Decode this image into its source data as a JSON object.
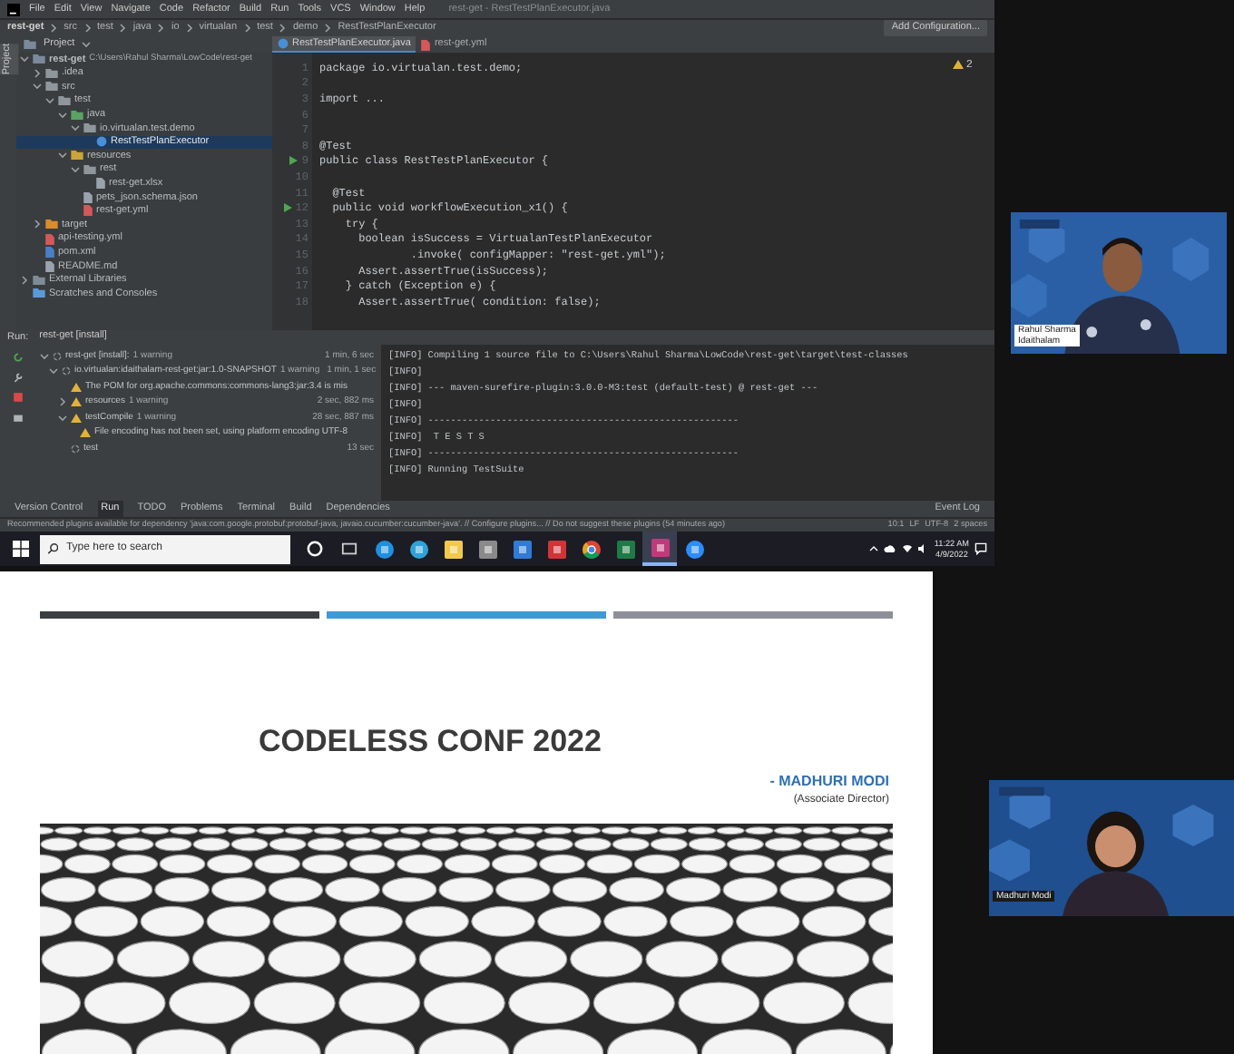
{
  "ide": {
    "menu": [
      "File",
      "Edit",
      "View",
      "Navigate",
      "Code",
      "Refactor",
      "Build",
      "Run",
      "Tools",
      "VCS",
      "Window",
      "Help"
    ],
    "title": "rest-get - RestTestPlanExecutor.java",
    "breadcrumbs": [
      "rest-get",
      "src",
      "test",
      "java",
      "io",
      "virtualan",
      "test",
      "demo",
      "RestTestPlanExecutor"
    ],
    "run_config": "Add Configuration...",
    "side_labels": [
      "Project"
    ],
    "project": {
      "title": "Project",
      "tree": [
        {
          "label": "rest-get",
          "detail": "C:\\Users\\Rahul Sharma\\LowCode\\rest-get",
          "kind": "module",
          "expanded": true,
          "selected": false,
          "children": [
            {
              "label": ".idea",
              "kind": "folder",
              "expanded": false,
              "selected": false
            },
            {
              "label": "src",
              "kind": "folder",
              "expanded": true,
              "selected": false,
              "children": [
                {
                  "label": "test",
                  "kind": "folder",
                  "expanded": true,
                  "selected": false,
                  "children": [
                    {
                      "label": "java",
                      "kind": "source",
                      "expanded": true,
                      "selected": false,
                      "children": [
                        {
                          "label": "io.virtualan.test.demo",
                          "kind": "package",
                          "expanded": true,
                          "selected": false,
                          "children": [
                            {
                              "label": "RestTestPlanExecutor",
                              "kind": "class",
                              "selected": true
                            }
                          ]
                        }
                      ]
                    },
                    {
                      "label": "resources",
                      "kind": "resource",
                      "expanded": true,
                      "selected": false,
                      "children": [
                        {
                          "label": "rest",
                          "kind": "folder",
                          "expanded": true,
                          "selected": false,
                          "children": [
                            {
                              "label": "rest-get.xlsx",
                              "kind": "file",
                              "selected": false
                            }
                          ]
                        },
                        {
                          "label": "pets_json.schema.json",
                          "kind": "file",
                          "selected": false
                        },
                        {
                          "label": "rest-get.yml",
                          "kind": "yml",
                          "selected": false
                        }
                      ]
                    }
                  ]
                }
              ]
            },
            {
              "label": "target",
              "kind": "excluded",
              "expanded": false,
              "selected": false
            },
            {
              "label": "api-testing.yml",
              "kind": "yml",
              "selected": false
            },
            {
              "label": "pom.xml",
              "kind": "maven",
              "selected": false
            },
            {
              "label": "README.md",
              "kind": "file",
              "selected": false
            }
          ]
        },
        {
          "label": "External Libraries",
          "kind": "library",
          "expanded": false,
          "selected": false
        },
        {
          "label": "Scratches and Consoles",
          "kind": "scratch",
          "selected": false
        }
      ]
    },
    "editor_tabs": [
      {
        "label": "RestTestPlanExecutor.java",
        "kind": "class",
        "selected": true
      },
      {
        "label": "rest-get.yml",
        "kind": "yml",
        "selected": false
      }
    ],
    "warnings": "2",
    "code": [
      {
        "n": "1",
        "text": "package io.virtualan.test.demo;",
        "run": false
      },
      {
        "n": "2",
        "run": false
      },
      {
        "n": "3",
        "text": "import ...",
        "run": false
      },
      {
        "n": "6",
        "run": false
      },
      {
        "n": "7",
        "run": false
      },
      {
        "n": "8",
        "text": "@Test",
        "run": false
      },
      {
        "n": "9",
        "text": "public class RestTestPlanExecutor {",
        "run": true
      },
      {
        "n": "10",
        "run": false
      },
      {
        "n": "11",
        "text": "  @Test",
        "run": false
      },
      {
        "n": "12",
        "text": "  public void workflowExecution_x1() {",
        "run": true
      },
      {
        "n": "13",
        "text": "    try {",
        "run": false
      },
      {
        "n": "14",
        "text": "      boolean isSuccess = VirtualanTestPlanExecutor",
        "run": false
      },
      {
        "n": "15",
        "text": "              .invoke( configMapper: \"rest-get.yml\");",
        "run": false
      },
      {
        "n": "16",
        "text": "      Assert.assertTrue(isSuccess);",
        "run": false
      },
      {
        "n": "17",
        "text": "    } catch (Exception e) {",
        "run": false
      },
      {
        "n": "18",
        "text": "      Assert.assertTrue( condition: false);",
        "run": false
      }
    ],
    "run_label": "Run:",
    "run_tab": "rest-get [install]",
    "run_tree": [
      {
        "label": "rest-get [install]:",
        "detail": "1 warning",
        "time": "1 min, 6 sec",
        "kind": "running",
        "expanded": true,
        "children": [
          {
            "label": "io.virtualan:idaithalam-rest-get:jar:1.0-SNAPSHOT",
            "detail": "1 warning",
            "time": "1 min, 1 sec",
            "kind": "running",
            "expanded": true,
            "children": [
              {
                "label": "The POM for org.apache.commons:commons-lang3:jar:3.4 is mis",
                "kind": "warning"
              },
              {
                "label": "resources",
                "detail": "1 warning",
                "time": "2 sec, 882 ms",
                "kind": "warning",
                "expanded": false
              },
              {
                "label": "testCompile",
                "detail": "1 warning",
                "time": "28 sec, 887 ms",
                "kind": "warning",
                "expanded": true,
                "children": [
                  {
                    "label": "File encoding has not been set, using platform encoding UTF-8",
                    "kind": "warning"
                  }
                ]
              },
              {
                "label": "test",
                "time": "13 sec",
                "kind": "running"
              }
            ]
          }
        ]
      }
    ],
    "console": [
      "[INFO] Compiling 1 source file to C:\\Users\\Rahul Sharma\\LowCode\\rest-get\\target\\test-classes",
      "[INFO]",
      "[INFO] --- maven-surefire-plugin:3.0.0-M3:test (default-test) @ rest-get ---",
      "[INFO]",
      "[INFO] -------------------------------------------------------",
      "[INFO]  T E S T S",
      "[INFO] -------------------------------------------------------",
      "[INFO] Running TestSuite"
    ],
    "tool_tabs": [
      {
        "label": "Version Control",
        "selected": false
      },
      {
        "label": "Run",
        "selected": true
      },
      {
        "label": "TODO",
        "selected": false
      },
      {
        "label": "Problems",
        "selected": false
      },
      {
        "label": "Terminal",
        "selected": false
      },
      {
        "label": "Build",
        "selected": false
      },
      {
        "label": "Dependencies",
        "selected": false
      }
    ],
    "event_log": "Event Log",
    "status_message": "Recommended plugins available for dependency 'java:com.google.protobuf:protobuf-java, javaio.cucumber:cucumber-java'. // Configure plugins... // Do not suggest these plugins (54 minutes ago)",
    "status_items": [
      "10:1",
      "LF",
      "UTF-8",
      "2 spaces"
    ]
  },
  "taskbar": {
    "search_placeholder": "Type here to search",
    "apps": [
      {
        "kind": "cortana",
        "selected": false
      },
      {
        "kind": "taskview",
        "selected": false
      },
      {
        "kind": "ie",
        "selected": false
      },
      {
        "kind": "edge",
        "selected": false
      },
      {
        "kind": "explorer",
        "selected": false
      },
      {
        "kind": "store",
        "selected": false
      },
      {
        "kind": "mail",
        "selected": false
      },
      {
        "kind": "office",
        "selected": false
      },
      {
        "kind": "chrome",
        "selected": false
      },
      {
        "kind": "excel",
        "selected": false
      },
      {
        "kind": "intellij",
        "selected": true
      },
      {
        "kind": "zoom",
        "selected": false
      }
    ],
    "time": "11:22 AM",
    "date": "4/9/2022"
  },
  "participants": [
    {
      "name": "Rahul Sharma",
      "org": "Idaithalam",
      "kind": "man"
    },
    {
      "name": "Madhuri Modi",
      "kind": "woman"
    }
  ],
  "slide": {
    "bars": [
      {
        "color": "#3b3f42"
      },
      {
        "color": "#3d9ad6"
      },
      {
        "color": "#8f8f99"
      }
    ],
    "title": "CODELESS CONF 2022",
    "speaker": "- MADHURI MODI",
    "role": "(Associate Director)",
    "kind": "picture"
  }
}
